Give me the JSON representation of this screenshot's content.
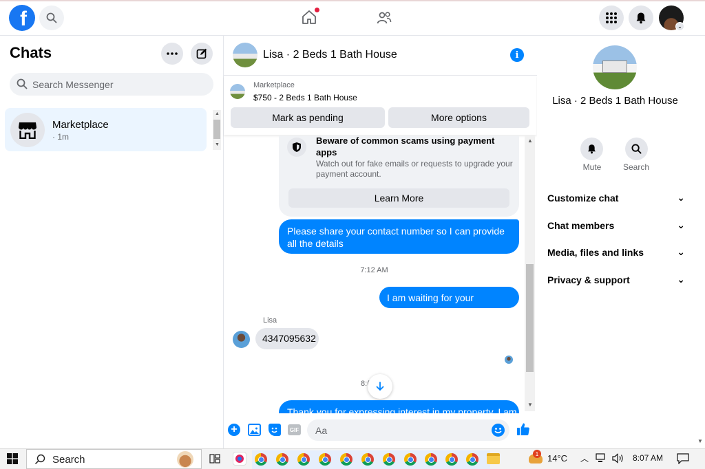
{
  "topbar": {
    "logo_letter": "f"
  },
  "left": {
    "title": "Chats",
    "search_placeholder": "Search Messenger",
    "chat_item": {
      "name": "Marketplace",
      "meta": "· 1m"
    }
  },
  "conversation": {
    "title": "Lisa · 2 Beds 1 Bath House",
    "market_label": "Marketplace",
    "market_listing": "$750 - 2 Beds 1 Bath House",
    "btn_pending": "Mark as pending",
    "btn_more": "More options",
    "scam_title": "Beware of common scams using payment apps",
    "scam_body": "Watch out for fake emails or requests to upgrade your payment account.",
    "learn_more": "Learn More",
    "msg1": "Please share your contact number so I can provide all the details",
    "time1": "7:12 AM",
    "msg2": "I am waiting for your response",
    "sender": "Lisa",
    "msg3": "4347095632",
    "time2_partial": "8:(",
    "msg4_partial": "Thank you for expressing interest in my property. I am",
    "composer_placeholder": "Aa"
  },
  "right": {
    "name": "Lisa · 2 Beds 1 Bath House",
    "mute": "Mute",
    "search": "Search",
    "rows": [
      "Customize chat",
      "Chat members",
      "Media, files and links",
      "Privacy & support"
    ]
  },
  "taskbar": {
    "search": "Search",
    "temperature": "14°C",
    "time": "8:07 AM",
    "weather_badge": "1"
  },
  "colors": {
    "brand": "#1877f2",
    "bubble": "#0084ff",
    "selected_chat": "#ebf5ff"
  }
}
